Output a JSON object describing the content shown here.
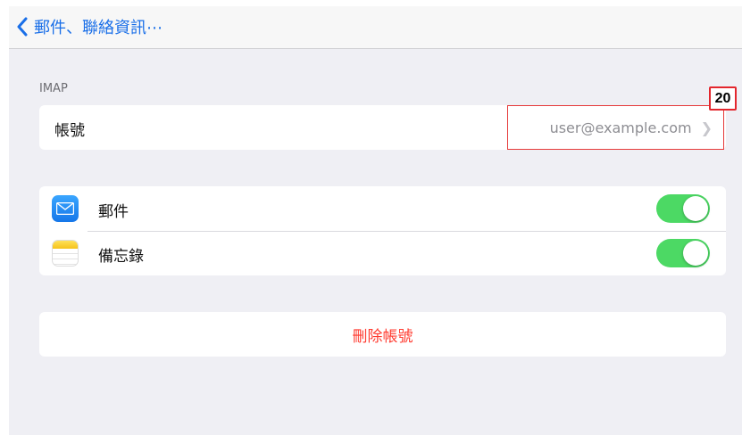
{
  "nav": {
    "back_label": "郵件、聯絡資訊⋯"
  },
  "section": {
    "label": "IMAP"
  },
  "account": {
    "label": "帳號",
    "value": "user@example.com"
  },
  "apps": [
    {
      "label": "郵件",
      "enabled": true
    },
    {
      "label": "備忘錄",
      "enabled": true
    }
  ],
  "actions": {
    "delete_label": "刪除帳號"
  },
  "annotation": {
    "badge": "20"
  },
  "colors": {
    "accent": "#1a6fe8",
    "toggle_on": "#4cd964",
    "destructive": "#ff3b30",
    "highlight": "#e63a3a"
  },
  "icons": {
    "back": "chevron-left-icon",
    "disclosure": "chevron-right-icon",
    "mail": "mail-app-icon",
    "notes": "notes-app-icon"
  }
}
